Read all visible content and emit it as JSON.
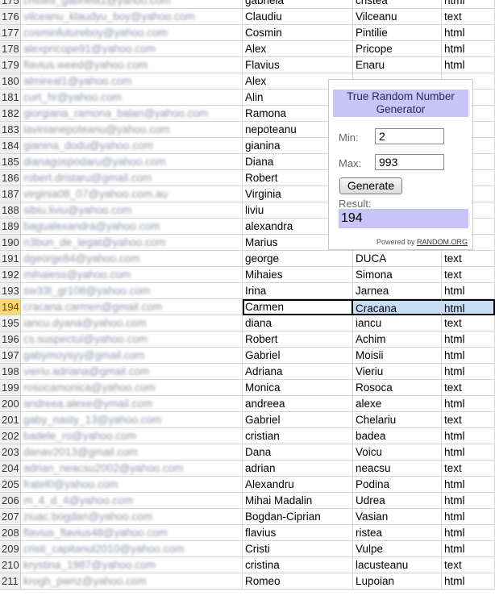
{
  "active_row": "194",
  "rows": [
    {
      "n": "175",
      "email": "cristea_gabriela1@yahoo.com",
      "first": "gabriela",
      "last": "cristea",
      "format": "html"
    },
    {
      "n": "176",
      "email": "vilceanu_klaudyu_boy@yahoo.com",
      "first": "Claudiu",
      "last": "Vilceanu",
      "format": "text"
    },
    {
      "n": "177",
      "email": "cosminfutureboy@yahoo.com",
      "first": "Cosmin",
      "last": "Pintilie",
      "format": "html"
    },
    {
      "n": "178",
      "email": "alexpricope91@yahoo.com",
      "first": "Alex",
      "last": "Pricope",
      "format": "html"
    },
    {
      "n": "179",
      "email": "flavius.weed@yahoo.com",
      "first": "Flavius",
      "last": "Enaru",
      "format": "html"
    },
    {
      "n": "180",
      "email": "almireal1@yahoo.com",
      "first": "Alex",
      "last": "",
      "format": ""
    },
    {
      "n": "181",
      "email": "curt_hr@yahoo.com",
      "first": "Alin",
      "last": "",
      "format": ""
    },
    {
      "n": "182",
      "email": "giorgiana_ramona_balan@yahoo.com",
      "first": "Ramona",
      "last": "",
      "format": ""
    },
    {
      "n": "183",
      "email": "lavinianepoteanu@yahoo.com",
      "first": "nepoteanu",
      "last": "",
      "format": ""
    },
    {
      "n": "184",
      "email": "gianina_dodu@yahoo.com",
      "first": "gianina",
      "last": "",
      "format": ""
    },
    {
      "n": "185",
      "email": "dianagospodaru@yahoo.com",
      "first": "Diana",
      "last": "",
      "format": ""
    },
    {
      "n": "186",
      "email": "robert.dristaru@gmail.com",
      "first": "Robert",
      "last": "",
      "format": ""
    },
    {
      "n": "187",
      "email": "virginia08_07@yahoo.com.au",
      "first": "Virginia",
      "last": "",
      "format": ""
    },
    {
      "n": "188",
      "email": "sibiu.liviu@yahoo.com",
      "first": "liviu",
      "last": "",
      "format": ""
    },
    {
      "n": "189",
      "email": "bagualexandra@yahoo.com",
      "first": "alexandra",
      "last": "",
      "format": ""
    },
    {
      "n": "190",
      "email": "n3bun_de_legat@yahoo.com",
      "first": "Marius",
      "last": "",
      "format": ""
    },
    {
      "n": "191",
      "email": "dgeorge84@yahoo.com",
      "first": "george",
      "last": "DUCA",
      "format": "text"
    },
    {
      "n": "192",
      "email": "mihaiess@yahoo.com",
      "first": "Mihaies",
      "last": "Simona",
      "format": "text"
    },
    {
      "n": "193",
      "email": "sw33t_gr108@yahoo.com",
      "first": "Irina",
      "last": "Jarnea",
      "format": "html"
    },
    {
      "n": "194",
      "email": "cracana.carmen@gmail.com",
      "first": "Carmen",
      "last": "Cracana",
      "format": "html"
    },
    {
      "n": "195",
      "email": "iancu.dyana@yahoo.com",
      "first": "diana",
      "last": "iancu",
      "format": "text"
    },
    {
      "n": "196",
      "email": "cs.suspectul@yahoo.com",
      "first": "Robert",
      "last": "Achim",
      "format": "html"
    },
    {
      "n": "197",
      "email": "gabymoysyy@gmail.com",
      "first": "Gabriel",
      "last": "Moisii",
      "format": "html"
    },
    {
      "n": "198",
      "email": "vieriu.adriana@gmail.com",
      "first": "Adriana",
      "last": "Vieriu",
      "format": "html"
    },
    {
      "n": "199",
      "email": "rosocamonica@yahoo.com",
      "first": "Monica",
      "last": "Rosoca",
      "format": "text"
    },
    {
      "n": "200",
      "email": "andreea.alexe@ymail.com",
      "first": "andreea",
      "last": "alexe",
      "format": "html"
    },
    {
      "n": "201",
      "email": "gaby_nasty_13@yahoo.com",
      "first": "Gabriel",
      "last": "Chelariu",
      "format": "text"
    },
    {
      "n": "202",
      "email": "badele_ro@yahoo.com",
      "first": "cristian",
      "last": "badea",
      "format": "html"
    },
    {
      "n": "203",
      "email": "danav2013@gmail.com",
      "first": "Dana",
      "last": "Voicu",
      "format": "html"
    },
    {
      "n": "204",
      "email": "adrian_neacsu2002@yahoo.com",
      "first": "adrian",
      "last": "neacsu",
      "format": "text"
    },
    {
      "n": "205",
      "email": "fratel0@yahoo.com",
      "first": "Alexandru",
      "last": "Podina",
      "format": "html"
    },
    {
      "n": "206",
      "email": "m_4_d_4@yahoo.com",
      "first": "Mihai Madalin",
      "last": "Udrea",
      "format": "html"
    },
    {
      "n": "207",
      "email": "ziuac.bogdan@yahoo.com",
      "first": "Bogdan-Ciprian",
      "last": "Vasian",
      "format": "html"
    },
    {
      "n": "208",
      "email": "flavius_flavius48@yahoo.com",
      "first": "flavius",
      "last": "ristea",
      "format": "html"
    },
    {
      "n": "209",
      "email": "cristi_capitanul2010@yahoo.com",
      "first": "Cristi",
      "last": "Vulpe",
      "format": "html"
    },
    {
      "n": "210",
      "email": "krystina_1987@yahoo.com",
      "first": "cristina",
      "last": "lacusteanu",
      "format": "text"
    },
    {
      "n": "211",
      "email": "krogh_pwnz@yahoo.com",
      "first": "Romeo",
      "last": "Lupoian",
      "format": "html"
    }
  ],
  "widget": {
    "title": "True Random Number Generator",
    "min_label": "Min:",
    "min_value": "2",
    "max_label": "Max:",
    "max_value": "993",
    "generate_label": "Generate",
    "result_label": "Result:",
    "result_value": "194",
    "powered_prefix": "Powered by",
    "powered_link": "RANDOM.ORG"
  },
  "colors": {
    "active_row_header": "#fad675",
    "widget_accent": "#c9c6f7",
    "selection": "#c6def6"
  }
}
